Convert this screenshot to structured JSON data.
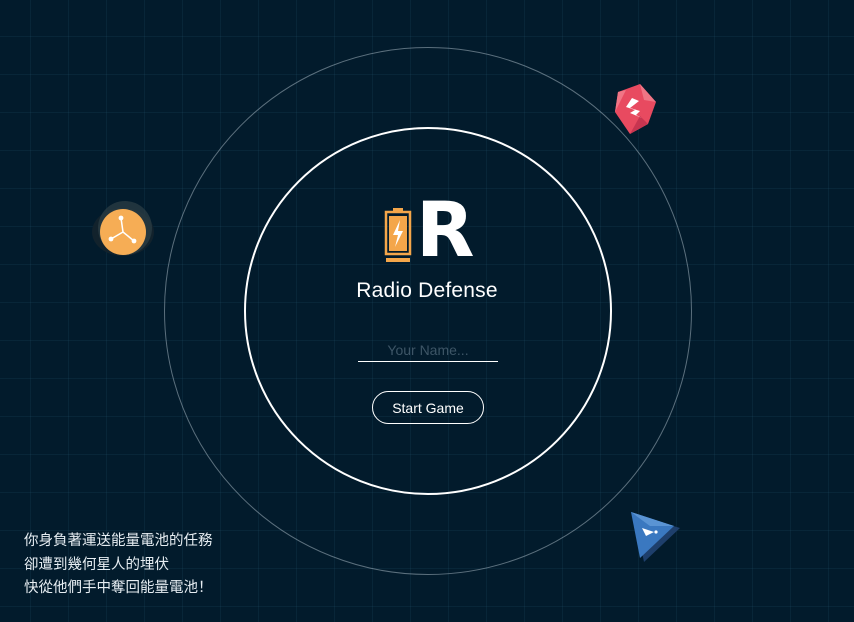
{
  "game": {
    "title": "Radio Defense",
    "logo_letter": "R"
  },
  "form": {
    "name_placeholder": "Your Name...",
    "name_value": "",
    "start_label": "Start Game"
  },
  "story": {
    "lines": [
      "你身負著運送能量電池的任務",
      "卻遭到幾何星人的埋伏",
      "快從他們手中奪回能量電池！"
    ]
  },
  "icons": {
    "logo": "battery-icon",
    "enemies": [
      "orange-circle-enemy-icon",
      "red-gem-enemy-icon",
      "blue-triangle-enemy-icon"
    ]
  },
  "colors": {
    "background": "#021b2c",
    "battery": "#f4a64a",
    "orange_enemy": "#f6ad55",
    "red_enemy": "#e84a60",
    "blue_enemy": "#3a78c0"
  }
}
